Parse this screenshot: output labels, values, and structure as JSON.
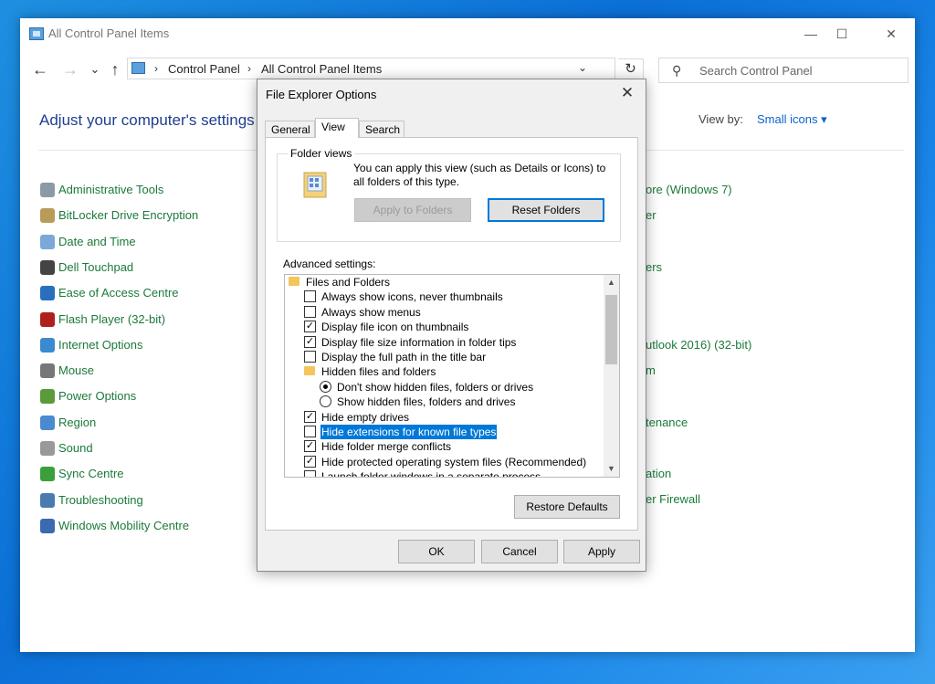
{
  "window": {
    "title": "All Control Panel Items",
    "minimize": "—",
    "maximize": "☐",
    "close": "✕"
  },
  "nav": {
    "back": "←",
    "forward": "→",
    "history": "⌄",
    "up": "↑",
    "breadcrumb": [
      "Control Panel",
      "All Control Panel Items"
    ],
    "separator": "›",
    "dropdown": "⌄",
    "refresh": "↻",
    "search_placeholder": "Search Control Panel"
  },
  "page": {
    "heading": "Adjust your computer's settings",
    "view_by_label": "View by:",
    "view_by_value": "Small icons ▾"
  },
  "items_left": [
    {
      "label": "Administrative Tools",
      "icon": "admin-tools-icon",
      "color": "#8c9aa8"
    },
    {
      "label": "BitLocker Drive Encryption",
      "icon": "bitlocker-icon",
      "color": "#b89a5a"
    },
    {
      "label": "Date and Time",
      "icon": "clock-icon",
      "color": "#7aa8d8"
    },
    {
      "label": "Dell Touchpad",
      "icon": "touchpad-icon",
      "color": "#444444"
    },
    {
      "label": "Ease of Access Centre",
      "icon": "ease-of-access-icon",
      "color": "#2a6ec0"
    },
    {
      "label": "Flash Player (32-bit)",
      "icon": "flash-icon",
      "color": "#b0201a"
    },
    {
      "label": "Internet Options",
      "icon": "globe-icon",
      "color": "#3a8ad0"
    },
    {
      "label": "Mouse",
      "icon": "mouse-icon",
      "color": "#777777"
    },
    {
      "label": "Power Options",
      "icon": "power-icon",
      "color": "#5a9a3a"
    },
    {
      "label": "Region",
      "icon": "region-icon",
      "color": "#4a8ad0"
    },
    {
      "label": "Sound",
      "icon": "speaker-icon",
      "color": "#999999"
    },
    {
      "label": "Sync Centre",
      "icon": "sync-icon",
      "color": "#3aa03a"
    },
    {
      "label": "Troubleshooting",
      "icon": "troubleshoot-icon",
      "color": "#4a7ab0"
    },
    {
      "label": "Windows Mobility Centre",
      "icon": "mobility-icon",
      "color": "#3a6ab0"
    }
  ],
  "items_right_partial": [
    "ore (Windows 7)",
    "er",
    "ers",
    "utlook 2016) (32-bit)",
    "m",
    "tenance",
    "ation",
    "er Firewall"
  ],
  "dialog": {
    "title": "File Explorer Options",
    "close": "✕",
    "tabs": [
      "General",
      "View",
      "Search"
    ],
    "active_tab": "View",
    "folder_views": {
      "title": "Folder views",
      "text": "You can apply this view (such as Details or Icons) to all folders of this type.",
      "apply_label": "Apply to Folders",
      "reset_label": "Reset Folders"
    },
    "advanced_label": "Advanced settings:",
    "tree": [
      {
        "type": "folder",
        "level": 0,
        "label": "Files and Folders"
      },
      {
        "type": "checkbox",
        "level": 1,
        "checked": false,
        "label": "Always show icons, never thumbnails"
      },
      {
        "type": "checkbox",
        "level": 1,
        "checked": false,
        "label": "Always show menus"
      },
      {
        "type": "checkbox",
        "level": 1,
        "checked": true,
        "label": "Display file icon on thumbnails"
      },
      {
        "type": "checkbox",
        "level": 1,
        "checked": true,
        "label": "Display file size information in folder tips"
      },
      {
        "type": "checkbox",
        "level": 1,
        "checked": false,
        "label": "Display the full path in the title bar"
      },
      {
        "type": "folder",
        "level": 1,
        "label": "Hidden files and folders"
      },
      {
        "type": "radio",
        "level": 2,
        "checked": true,
        "label": "Don't show hidden files, folders or drives"
      },
      {
        "type": "radio",
        "level": 2,
        "checked": false,
        "label": "Show hidden files, folders and drives"
      },
      {
        "type": "checkbox",
        "level": 1,
        "checked": true,
        "label": "Hide empty drives"
      },
      {
        "type": "checkbox",
        "level": 1,
        "checked": false,
        "label": "Hide extensions for known file types",
        "selected": true
      },
      {
        "type": "checkbox",
        "level": 1,
        "checked": true,
        "label": "Hide folder merge conflicts"
      },
      {
        "type": "checkbox",
        "level": 1,
        "checked": true,
        "label": "Hide protected operating system files (Recommended)"
      },
      {
        "type": "checkbox",
        "level": 1,
        "checked": false,
        "label": "Launch folder windows in a separate process"
      }
    ],
    "check_mark": "✓",
    "scroll_up": "▲",
    "scroll_down": "▼",
    "restore_label": "Restore Defaults",
    "ok_label": "OK",
    "cancel_label": "Cancel",
    "apply_label": "Apply"
  }
}
